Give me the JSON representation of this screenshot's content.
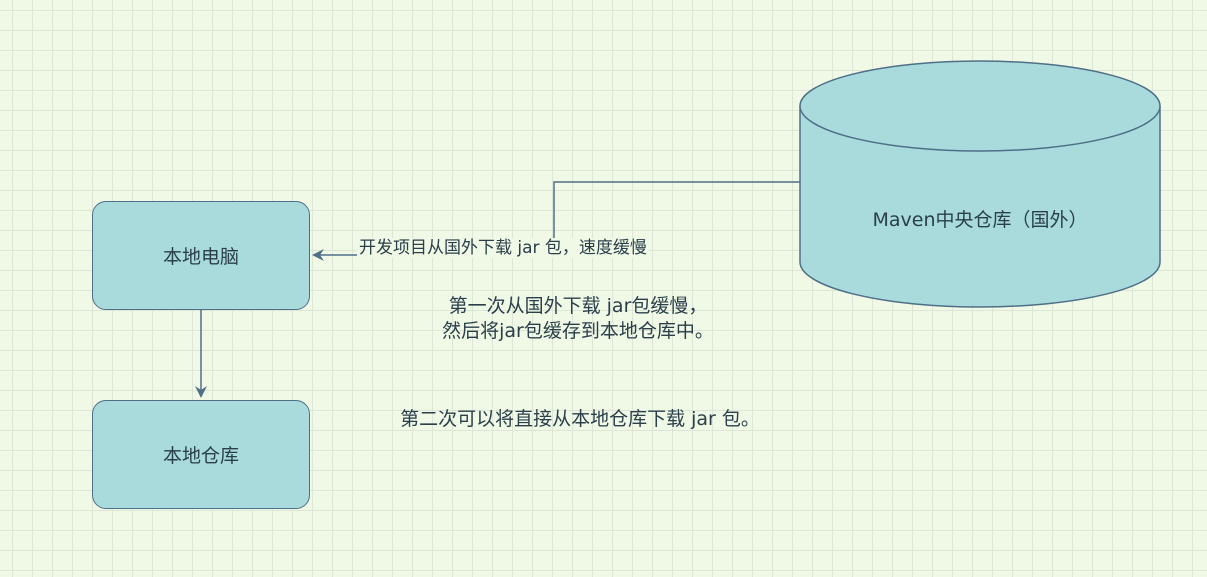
{
  "nodes": {
    "local_pc": "本地电脑",
    "local_repo": "本地仓库",
    "central_repo": "Maven中央仓库（国外）"
  },
  "edges": {
    "download_label": "开发项目从国外下载 jar 包，速度缓慢"
  },
  "notes": {
    "first_line1": "第一次从国外下载 jar包缓慢，",
    "first_line2": "然后将jar包缓存到本地仓库中。",
    "second": "第二次可以将直接从本地仓库下载 jar 包。"
  },
  "colors": {
    "background": "#f0f8e6",
    "grid": "#dde6d6",
    "node_fill": "#a9dbdc",
    "stroke": "#4f6f88",
    "text": "#2a3f4a"
  }
}
